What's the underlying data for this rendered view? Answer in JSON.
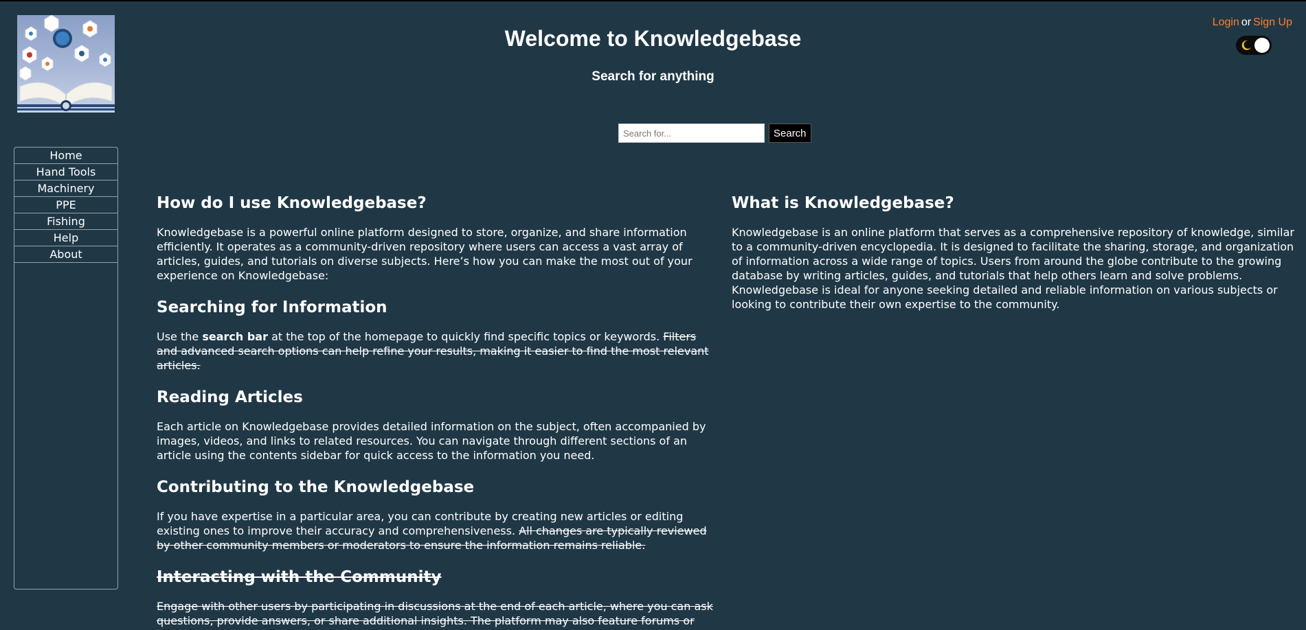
{
  "auth": {
    "login": "Login",
    "separator": "or",
    "signup": "Sign Up"
  },
  "header": {
    "title": "Welcome to Knowledgebase",
    "subtitle": "Search for anything"
  },
  "search": {
    "placeholder": "Search for...",
    "button": "Search"
  },
  "nav": [
    "Home",
    "Hand Tools",
    "Machinery",
    "PPE",
    "Fishing",
    "Help",
    "About"
  ],
  "left": {
    "heading": "How do I use Knowledgebase?",
    "intro": "Knowledgebase is a powerful online platform designed to store, organize, and share information efficiently. It operates as a community-driven repository where users can access a vast array of articles, guides, and tutorials on diverse subjects. Here’s how you can make the most out of your experience on Knowledgebase:",
    "searching": {
      "heading": "Searching for Information",
      "text_a": "Use the ",
      "text_bold": "search bar",
      "text_b": " at the top of the homepage to quickly find specific topics or keywords. ",
      "text_struck": "Filters and advanced search options can help refine your results, making it easier to find the most relevant articles."
    },
    "reading": {
      "heading": "Reading Articles",
      "text": "Each article on Knowledgebase provides detailed information on the subject, often accompanied by images, videos, and links to related resources. You can navigate through different sections of an article using the contents sidebar for quick access to the information you need."
    },
    "contributing": {
      "heading": "Contributing to the Knowledgebase",
      "text": "If you have expertise in a particular area, you can contribute by creating new articles or editing existing ones to improve their accuracy and comprehensiveness. ",
      "text_struck": "All changes are typically reviewed by other community members or moderators to ensure the information remains reliable."
    },
    "community": {
      "heading": "Interacting with the Community",
      "text": "Engage with other users by participating in discussions at the end of each article, where you can ask questions, provide answers, or share additional insights. The platform may also feature forums or user groups focused on specific topics, allowing for deeper interaction and learning."
    }
  },
  "right": {
    "heading": "What is Knowledgebase?",
    "text": "Knowledgebase is an online platform that serves as a comprehensive repository of knowledge, similar to a community-driven encyclopedia. It is designed to facilitate the sharing, storage, and organization of information across a wide range of topics. Users from around the globe contribute to the growing database by writing articles, guides, and tutorials that help others learn and solve problems. Knowledgebase is ideal for anyone seeking detailed and reliable information on various subjects or looking to contribute their own expertise to the community."
  },
  "colors": {
    "background": "#203846",
    "link": "#ff7f2a",
    "text": "#ffffff"
  },
  "icons": {
    "logo": "open-book-logo",
    "theme": "moon-icon"
  }
}
